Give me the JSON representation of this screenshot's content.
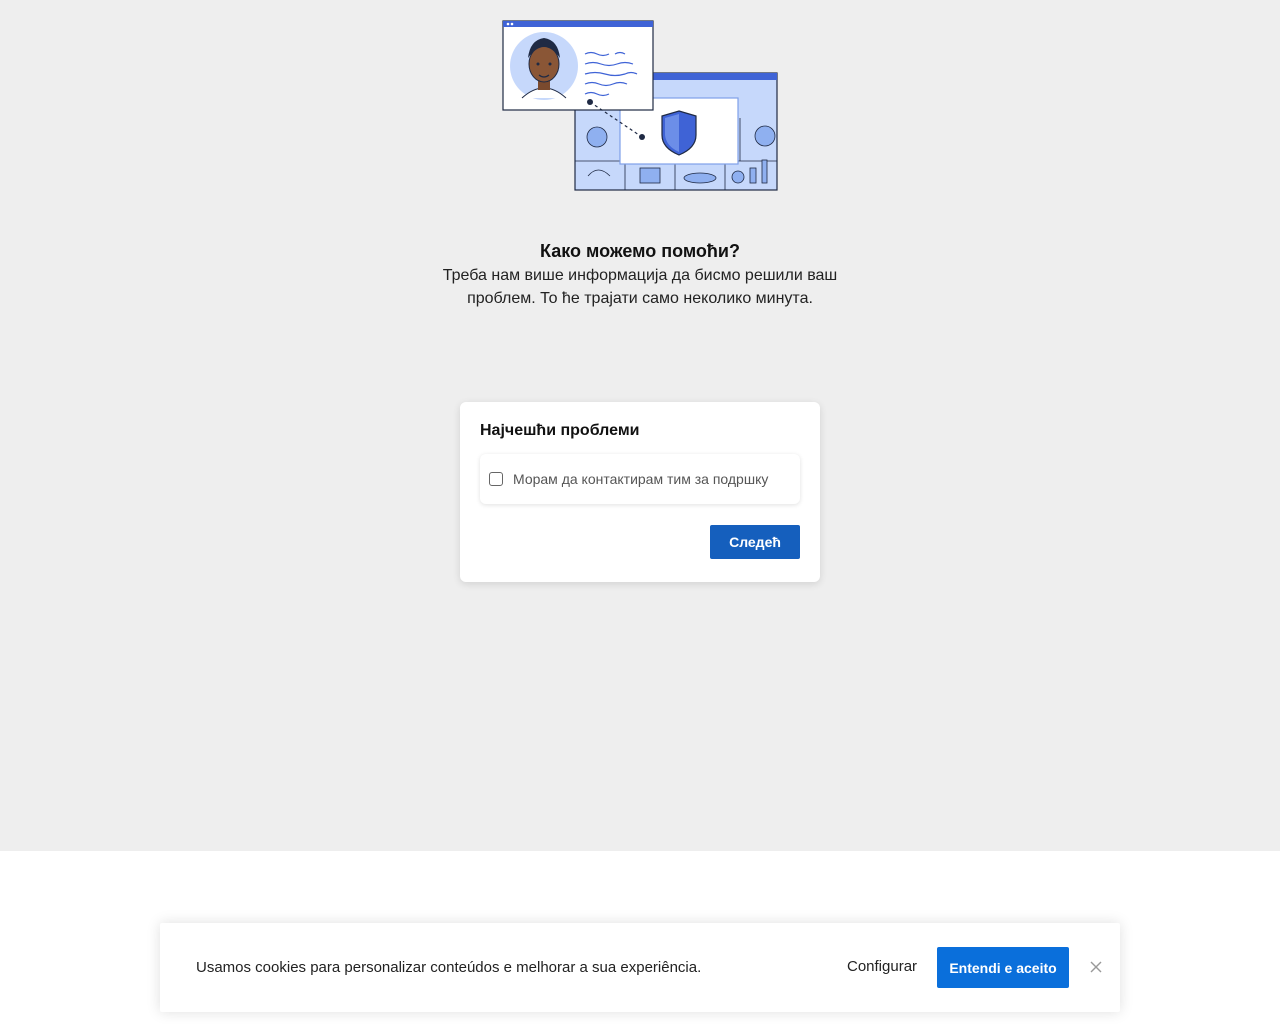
{
  "intro": {
    "title": "Како можемо помоћи?",
    "subtitle": "Треба нам више информација да бисмо решили ваш проблем. То ће трајати само неколико минута."
  },
  "card": {
    "title": "Најчешћи проблеми",
    "options": [
      {
        "label": "Морам да контактирам тим за подршку",
        "checked": false
      }
    ],
    "next_label": "Следећ"
  },
  "cookie_banner": {
    "text": "Usamos cookies para personalizar conteúdos e melhorar a sua experiência.",
    "configure_label": "Configurar",
    "accept_label": "Entendi e aceito",
    "close_icon": "close-icon"
  },
  "colors": {
    "page_background": "#eeeeee",
    "primary_button": "#155fbd",
    "cookie_accept_button": "#0a6fdb",
    "illustration_blue": "#3f63d6"
  }
}
